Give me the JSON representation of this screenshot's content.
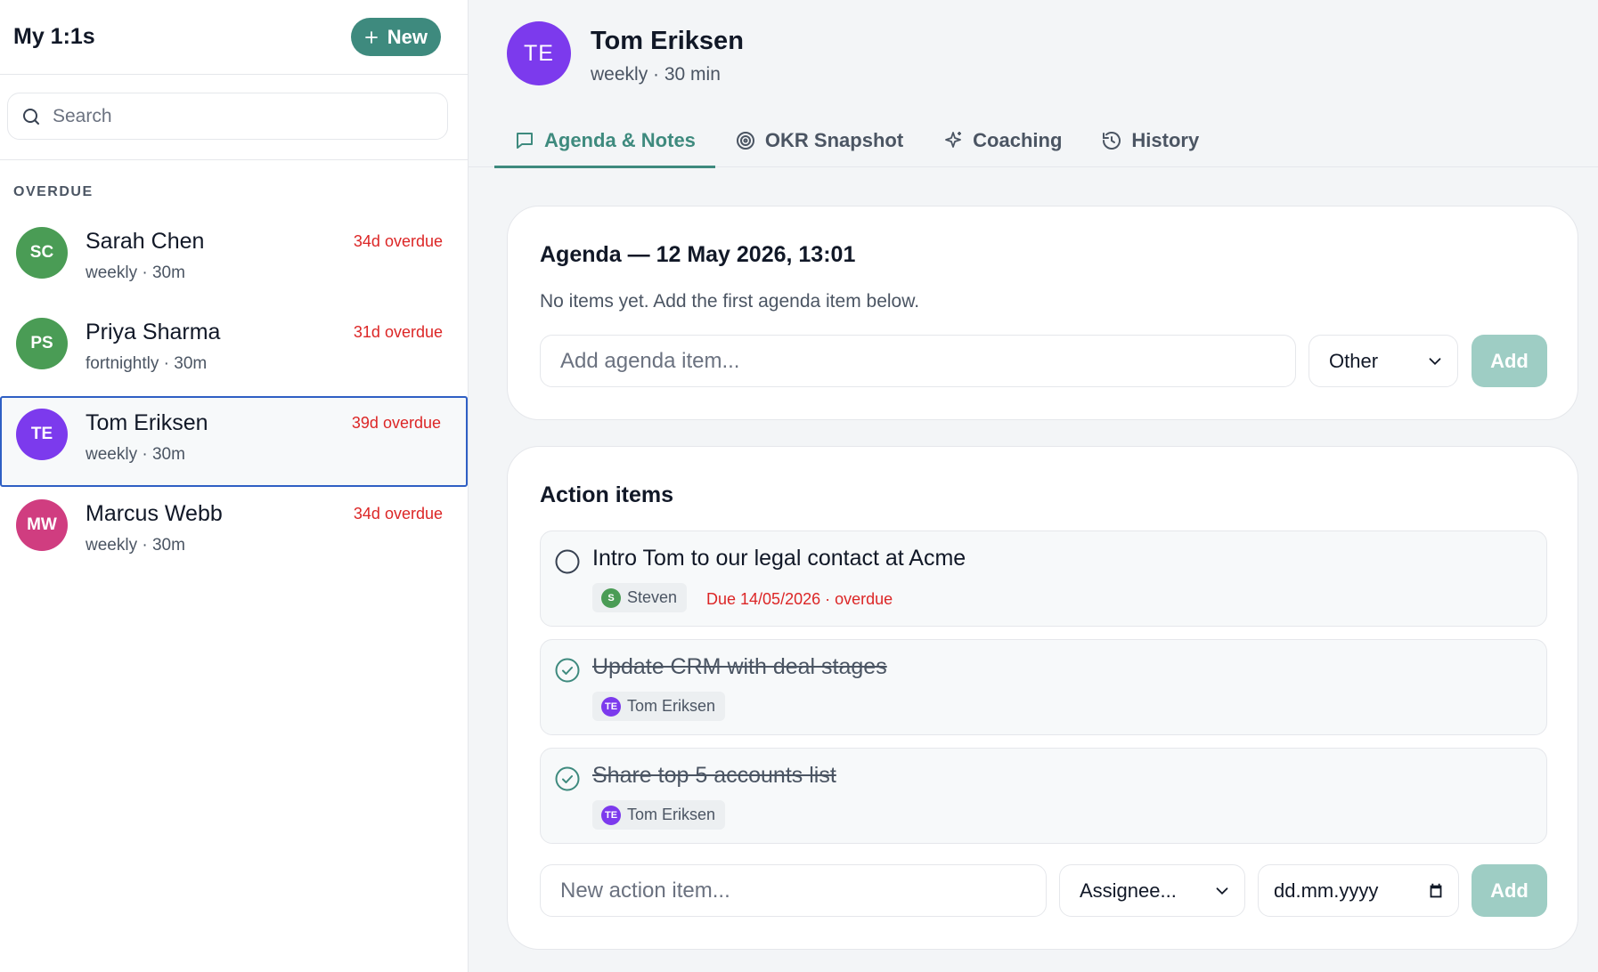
{
  "sidebar": {
    "title": "My 1:1s",
    "new_button": "New",
    "search_placeholder": "Search",
    "section_label": "OVERDUE",
    "people": [
      {
        "initials": "SC",
        "name": "Sarah Chen",
        "cadence": "weekly · 30m",
        "status": "34d overdue",
        "color": "#4a9c55"
      },
      {
        "initials": "PS",
        "name": "Priya Sharma",
        "cadence": "fortnightly · 30m",
        "status": "31d overdue",
        "color": "#4a9c55"
      },
      {
        "initials": "TE",
        "name": "Tom Eriksen",
        "cadence": "weekly · 30m",
        "status": "39d overdue",
        "color": "#7c3aed"
      },
      {
        "initials": "MW",
        "name": "Marcus Webb",
        "cadence": "weekly · 30m",
        "status": "34d overdue",
        "color": "#d03d80"
      }
    ],
    "selected_index": 2
  },
  "header": {
    "initials": "TE",
    "name": "Tom Eriksen",
    "subtitle": "weekly · 30 min",
    "avatar_color": "#7c3aed"
  },
  "tabs": [
    {
      "label": "Agenda & Notes",
      "icon": "message-square-icon",
      "active": true
    },
    {
      "label": "OKR Snapshot",
      "icon": "target-icon",
      "active": false
    },
    {
      "label": "Coaching",
      "icon": "sparkles-icon",
      "active": false
    },
    {
      "label": "History",
      "icon": "history-icon",
      "active": false
    }
  ],
  "agenda": {
    "title": "Agenda — 12 May 2026, 13:01",
    "empty_text": "No items yet. Add the first agenda item below.",
    "input_placeholder": "Add agenda item...",
    "category_value": "Other",
    "add_button": "Add"
  },
  "actions": {
    "title": "Action items",
    "items": [
      {
        "text": "Intro Tom to our legal contact at Acme",
        "done": false,
        "assignee_initial": "S",
        "assignee": "Steven",
        "assignee_color": "#4a9c55",
        "due": "Due 14/05/2026 · overdue"
      },
      {
        "text": "Update CRM with deal stages",
        "done": true,
        "assignee_initial": "TE",
        "assignee": "Tom Eriksen",
        "assignee_color": "#7c3aed"
      },
      {
        "text": "Share top 5 accounts list",
        "done": true,
        "assignee_initial": "TE",
        "assignee": "Tom Eriksen",
        "assignee_color": "#7c3aed"
      }
    ],
    "new_placeholder": "New action item...",
    "assignee_placeholder": "Assignee...",
    "date_placeholder": "dd.mm.yyyy",
    "add_button": "Add"
  },
  "colors": {
    "accent": "#3e8a7e",
    "accent_disabled": "#9ecdc4",
    "overdue": "#dc2626",
    "selection_border": "#2f5fc4"
  }
}
